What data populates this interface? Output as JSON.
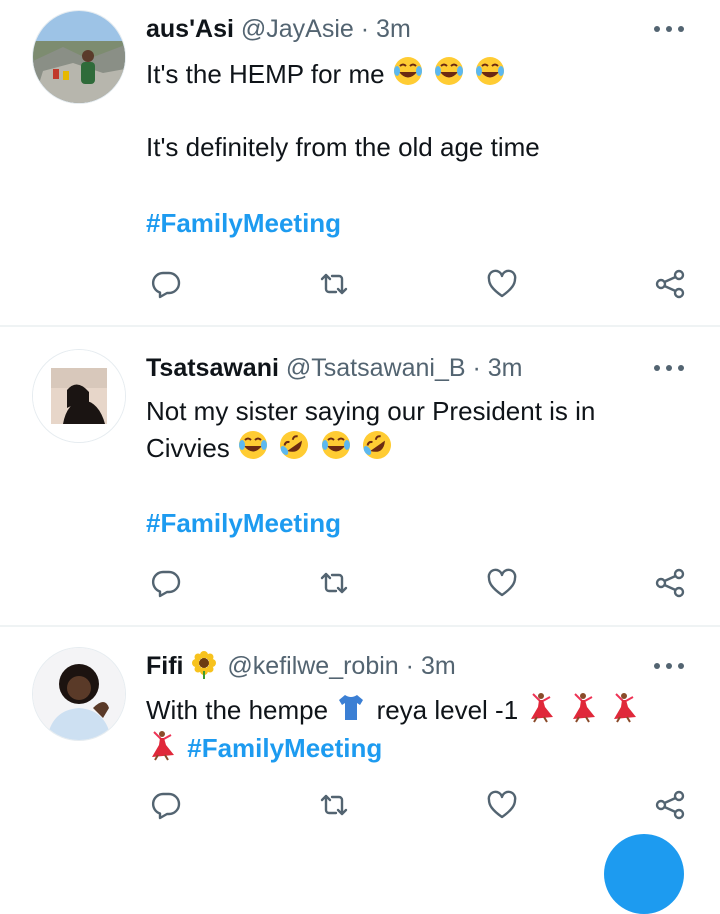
{
  "tweets": [
    {
      "name": "aus'Asi",
      "handle": "@JayAsie",
      "sep": "·",
      "time": "3m",
      "line1": "It's the HEMP for me",
      "line1_emojis": [
        "joy-emoji",
        "joy-emoji",
        "joy-emoji"
      ],
      "line2": "It's definitely from the old age time",
      "hashtag": "#FamilyMeeting"
    },
    {
      "name": "Tsatsawani",
      "handle": "@Tsatsawani_B",
      "sep": "·",
      "time": "3m",
      "line1": "Not my sister saying our President is in",
      "line2": "Civvies",
      "line2_emojis": [
        "joy-emoji",
        "rofl-emoji",
        "joy-emoji",
        "rofl-emoji"
      ],
      "hashtag": "#FamilyMeeting"
    },
    {
      "name": "Fifi",
      "name_emoji": "sunflower-emoji",
      "handle": "@kefilwe_robin",
      "sep": "·",
      "time": "3m",
      "line1_a": "With the hempe",
      "line1_emoji": "tshirt-emoji",
      "line1_b": "reya level -1",
      "line1_tail_emojis": [
        "dancer-emoji",
        "dancer-emoji",
        "dancer-emoji"
      ],
      "line2_emoji": "dancer-emoji",
      "hashtag": "#FamilyMeeting"
    }
  ],
  "colors": {
    "accent": "#1d9bf0",
    "text": "#0f1419",
    "secondary": "#536471",
    "divider": "#eff3f4"
  },
  "icons": [
    "reply-icon",
    "retweet-icon",
    "like-icon",
    "share-icon",
    "more-icon"
  ]
}
